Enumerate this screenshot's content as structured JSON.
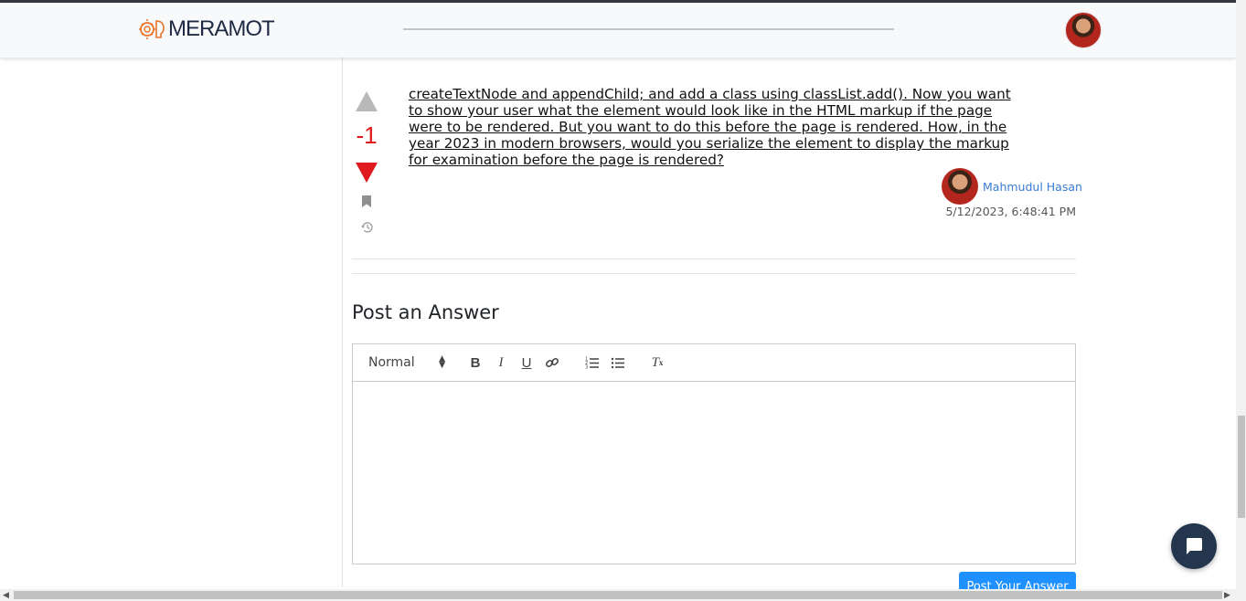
{
  "header": {
    "logo_text": "MERAMOT",
    "user_avatar": "user-avatar"
  },
  "question": {
    "vote_score": "-1",
    "body": "createTextNode and appendChild; and add a class using classList.add(). Now you want to show your user what the element would look like in the HTML markup if the page were to be rendered. But you want to do this before the page is rendered. How, in the year 2023 in modern browsers, would you serialize the element to display the markup for examination before the page is rendered?",
    "author_name": "Mahmudul Hasan",
    "date": "5/12/2023, 6:48:41 PM"
  },
  "answer_form": {
    "heading": "Post an Answer",
    "format_select": "Normal",
    "toolbar": {
      "bold": "B",
      "italic": "I",
      "underline": "U",
      "clean": "T",
      "clean_sub": "x"
    },
    "submit_label": "Post Your Answer"
  },
  "colors": {
    "accent": "#1e90ff",
    "downvote": "#e0191e",
    "author_link": "#3a7bd5",
    "logo_orange": "#e8742a",
    "logo_navy": "#1f2a44",
    "chat_fab": "#23364e"
  },
  "icons": [
    "logo-icon",
    "upvote-icon",
    "downvote-icon",
    "bookmark-icon",
    "history-icon",
    "link-icon",
    "ordered-list-icon",
    "bullet-list-icon",
    "clear-format-icon",
    "chat-icon"
  ]
}
